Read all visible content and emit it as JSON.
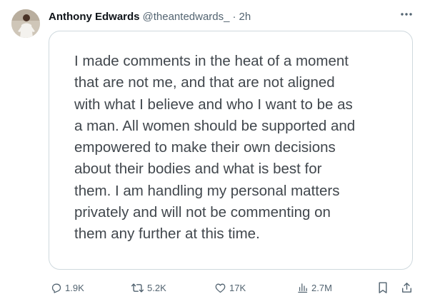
{
  "tweet": {
    "author": {
      "display_name": "Anthony Edwards",
      "handle": "@theantedwards_",
      "separator": "·",
      "timestamp": "2h"
    },
    "statement_text": "I made comments in the heat of a moment\nthat are not me, and that are not aligned\nwith what I believe and who I want to be as\na man. All women should be supported and\nempowered to make their own decisions\nabout their bodies and what is best for\nthem. I am handling my personal matters\nprivately and will not be commenting on\nthem any further at this time.",
    "metrics": {
      "replies": "1.9K",
      "retweets": "5.2K",
      "likes": "17K",
      "views": "2.7M"
    },
    "icons": {
      "more": "more-icon",
      "reply": "reply-icon",
      "retweet": "retweet-icon",
      "like": "heart-icon",
      "views": "views-icon",
      "bookmark": "bookmark-icon",
      "share": "share-icon"
    },
    "colors": {
      "text_primary": "#0f1419",
      "text_secondary": "#536471",
      "card_border": "#cfd9de",
      "statement_text": "#41474d"
    }
  }
}
